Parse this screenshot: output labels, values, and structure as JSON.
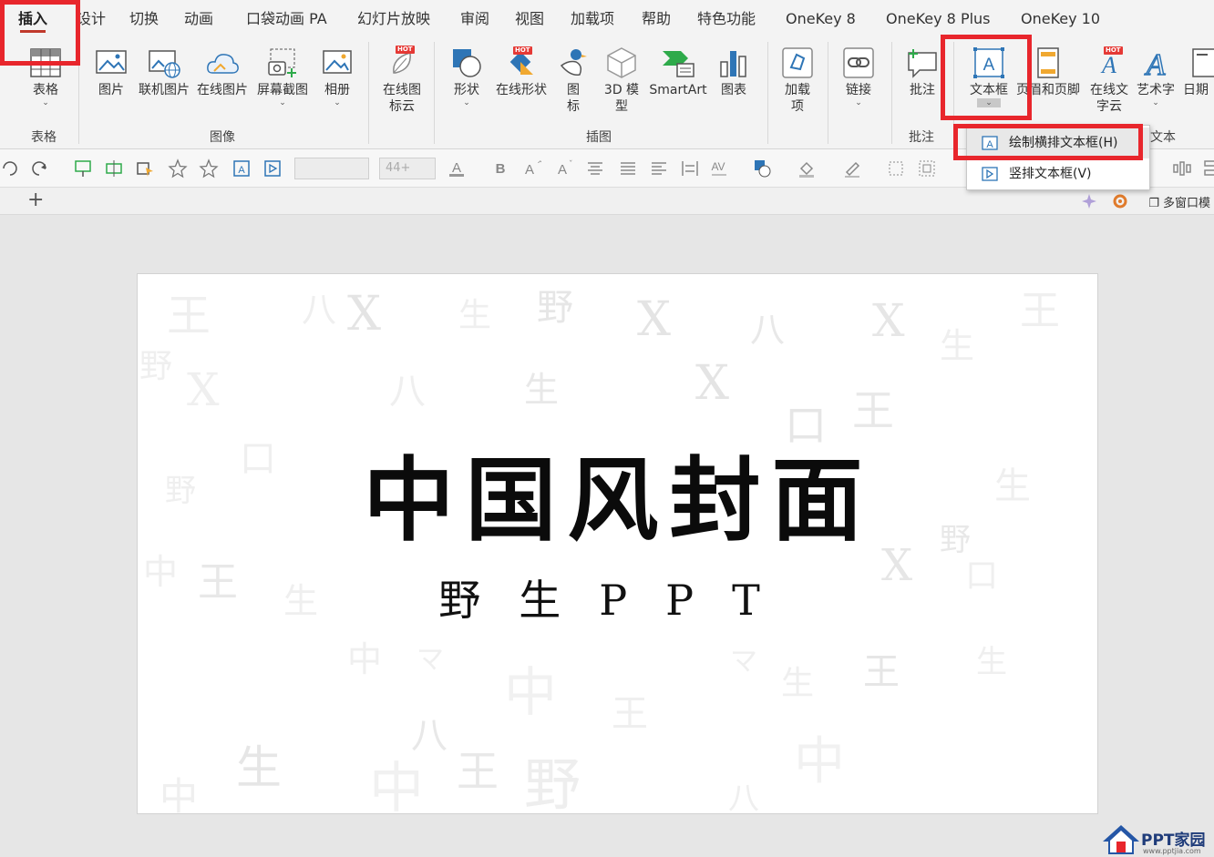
{
  "tabs": [
    "插入",
    "设计",
    "切换",
    "动画",
    "口袋动画 PA",
    "幻灯片放映",
    "审阅",
    "视图",
    "加载项",
    "帮助",
    "特色功能",
    "OneKey 8",
    "OneKey 8 Plus",
    "OneKey 10"
  ],
  "ribbon": {
    "buttons": {
      "table": "表格",
      "picture": "图片",
      "online_picture": "联机图片",
      "web_picture": "在线图片",
      "screenshot": "屏幕截图",
      "album": "相册",
      "icon_cloud": "在线图标云",
      "shapes": "形状",
      "online_shapes": "在线形状",
      "icons": "图标",
      "model3d": "3D 模型",
      "smartart": "SmartArt",
      "chart": "图表",
      "addins": "加载项",
      "link": "链接",
      "comment": "批注",
      "textbox": "文本框",
      "header_footer": "页眉和页脚",
      "wordcloud": "在线文字云",
      "wordart": "艺术字",
      "datetime": "日期"
    },
    "hot_badge": "HOT",
    "groups": {
      "table": "表格",
      "images": "图像",
      "illustrations": "插图",
      "comments": "批注",
      "text": "文本"
    }
  },
  "toolbar": {
    "font_size": "44+"
  },
  "docbar": {
    "add": "+",
    "multiwindow": "多窗口模"
  },
  "dropdown": {
    "items": [
      "绘制横排文本框(H)",
      "竖排文本框(V)"
    ]
  },
  "slide": {
    "title": "中国风封面",
    "subtitle": "野生PPT",
    "bg_chars": [
      "王",
      "八",
      "X",
      "生",
      "野",
      "中",
      "口",
      "マ"
    ]
  },
  "watermark": {
    "name": "PPT家园",
    "url": "www.pptjia.com"
  },
  "colors": {
    "accent": "#e8262c",
    "tab_underline": "#c0392b",
    "icon_blue": "#2e75b6"
  }
}
